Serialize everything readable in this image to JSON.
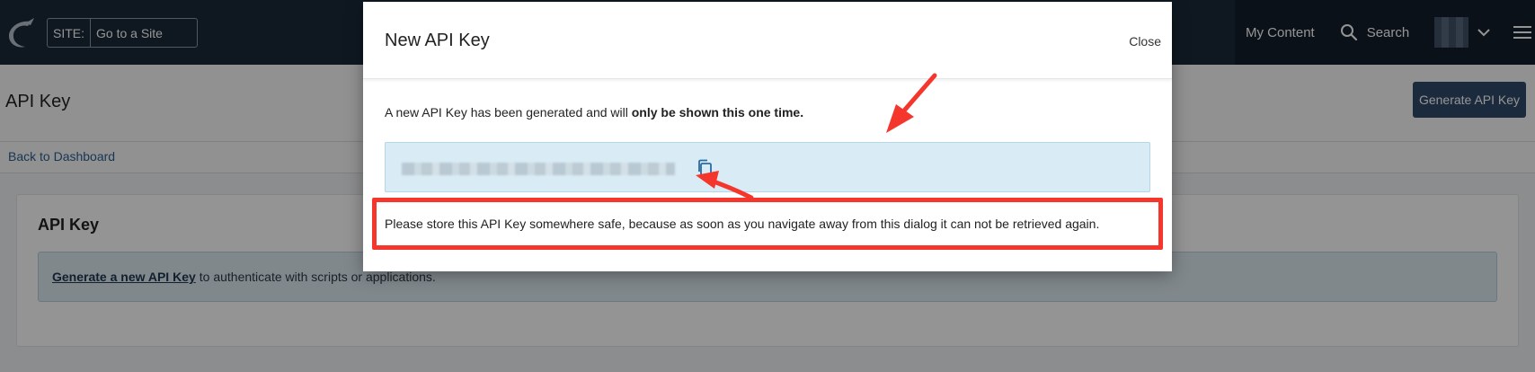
{
  "header": {
    "site_label": "SITE:",
    "site_placeholder": "Go to a Site",
    "my_content": "My Content",
    "search": "Search"
  },
  "page": {
    "title": "API Key",
    "generate_button": "Generate API Key",
    "back_link": "Back to Dashboard",
    "card_title": "API Key",
    "card_link": "Generate a new API Key",
    "card_text": "to authenticate with scripts or applications."
  },
  "modal": {
    "title": "New API Key",
    "close": "Close",
    "message_prefix": "A new API Key has been generated and will ",
    "message_bold": "only be shown this one time.",
    "warning": "Please store this API Key somewhere safe, because as soon as you navigate away from this dialog it can not be retrieved again."
  },
  "icons": {
    "logo": "bird-logo-icon",
    "search": "search-icon",
    "caret": "chevron-down-icon",
    "menu": "hamburger-menu-icon",
    "copy": "copy-icon"
  },
  "colors": {
    "topbar": "#1b2a3a",
    "primary_button": "#2f4b69",
    "annotation_red": "#f4362c",
    "key_box": "#d9ecf5"
  }
}
